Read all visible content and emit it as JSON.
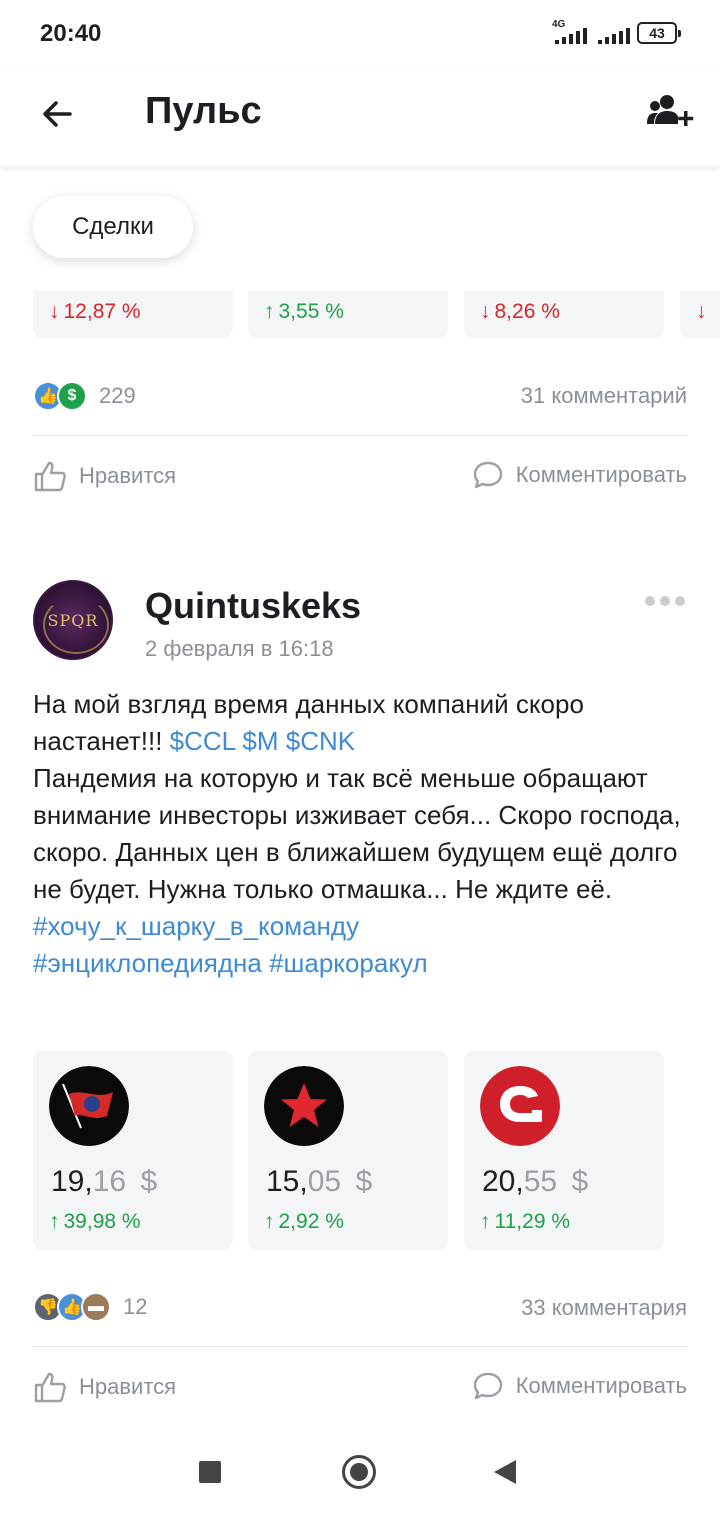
{
  "status_bar": {
    "time": "20:40",
    "network": "4G",
    "battery": "43"
  },
  "header": {
    "title": "Пульс"
  },
  "filter_chip": {
    "label": "Сделки"
  },
  "top_cards": [
    {
      "change": "12,87 %",
      "direction": "down"
    },
    {
      "change": "3,55 %",
      "direction": "up"
    },
    {
      "change": "8,26 %",
      "direction": "down"
    }
  ],
  "post1": {
    "reactions_count": "229",
    "comments": "31 комментарий"
  },
  "actions": {
    "like": "Нравится",
    "comment": "Комментировать"
  },
  "post2": {
    "author": "Quintuskeks",
    "avatar_text": "SPQR",
    "date": "2 февраля в 16:18",
    "text": {
      "line1": "На мой взгляд время данных компаний скоро",
      "line2": "настанет!!!",
      "tickers": "$CCL $M $CNK",
      "body": "Пандемия на которую и так всё меньше обращают внимание инвесторы изживает себя... Скоро господа, скоро. Данных цен в ближайшем будущем ещё долго не будет. Нужна только отмашка... Не ждите её.",
      "hashtag1": "#хочу_к_шарку_в_команду",
      "hashtag2": "#энциклопедиядна",
      "hashtag3": "#шаркоракул"
    },
    "tickers": [
      {
        "name": "CCL",
        "price_int": "19,",
        "price_dec": "16",
        "currency": "$",
        "change": "39,98 %"
      },
      {
        "name": "M",
        "price_int": "15,",
        "price_dec": "05",
        "currency": "$",
        "change": "2,92 %"
      },
      {
        "name": "CNK",
        "price_int": "20,",
        "price_dec": "55",
        "currency": "$",
        "change": "11,29 %"
      }
    ],
    "reactions_count": "12",
    "comments": "33 комментария"
  },
  "colors": {
    "link": "#3f8ad2",
    "positive": "#1fa04a",
    "negative": "#dd2424",
    "muted": "#8a9099"
  },
  "icons": [
    "back-arrow-icon",
    "add-user-icon",
    "like-icon",
    "comment-icon",
    "more-icon"
  ]
}
